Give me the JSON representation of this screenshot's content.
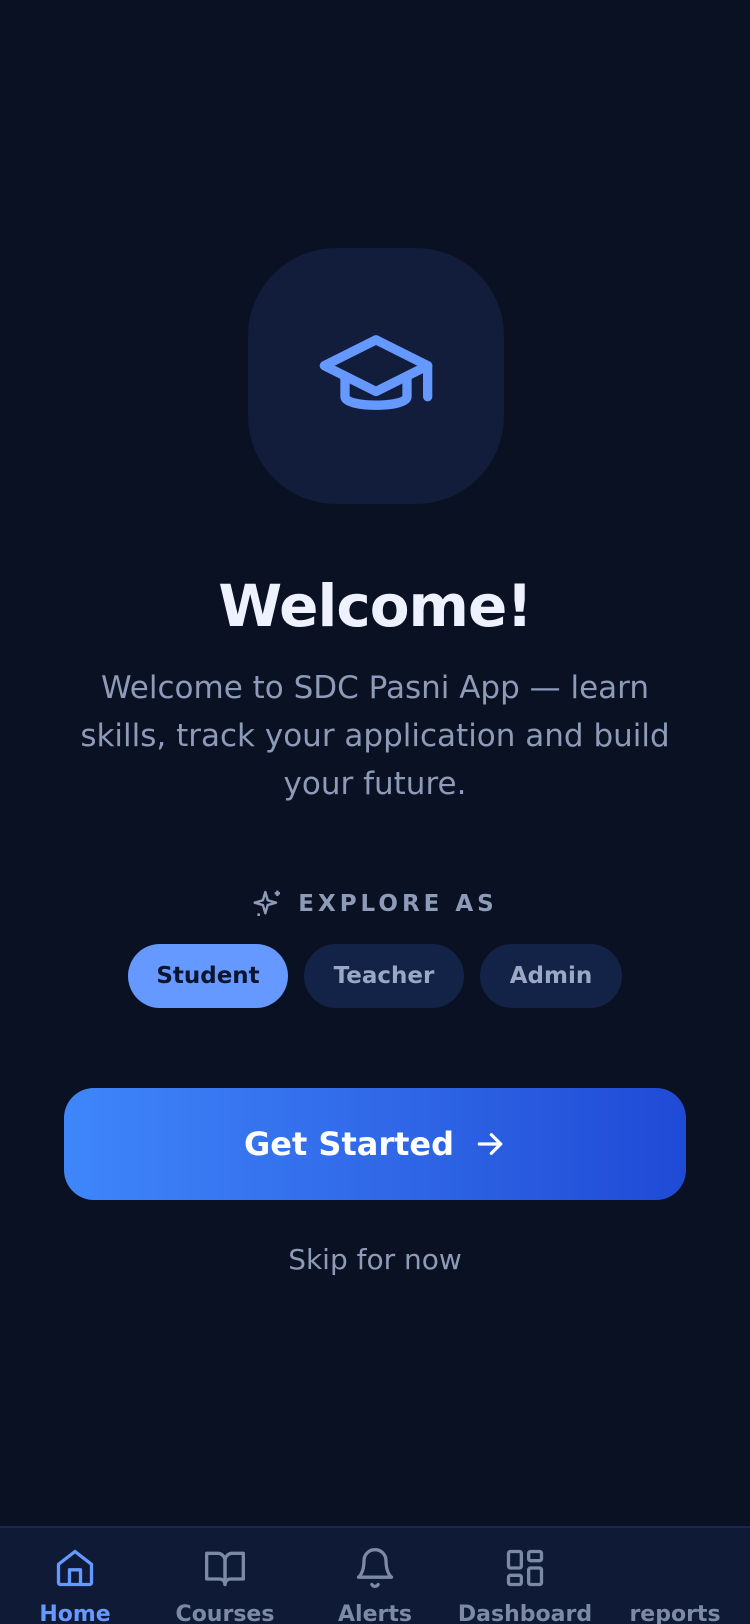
{
  "hero": {
    "icon": "graduation-cap-icon",
    "accent": "#6699ff"
  },
  "title": "Welcome!",
  "subtitle": "Welcome to SDC Pasni App — learn skills, track your application and build your future.",
  "explore": {
    "icon": "sparkle-icon",
    "label": "EXPLORE AS"
  },
  "roles": [
    {
      "label": "Student",
      "selected": true
    },
    {
      "label": "Teacher",
      "selected": false
    },
    {
      "label": "Admin",
      "selected": false
    }
  ],
  "cta": {
    "label": "Get Started",
    "icon": "arrow-right-icon"
  },
  "skip_label": "Skip for now",
  "tabs": [
    {
      "label": "Home",
      "icon": "home-icon",
      "active": true
    },
    {
      "label": "Courses",
      "icon": "book-open-icon",
      "active": false
    },
    {
      "label": "Alerts",
      "icon": "bell-icon",
      "active": false
    },
    {
      "label": "Dashboard",
      "icon": "grid-icon",
      "active": false
    },
    {
      "label": "reports",
      "icon": "report-icon",
      "active": false
    }
  ],
  "colors": {
    "background": "#0a1122",
    "surface": "#111d3a",
    "accent": "#6699ff",
    "cta_start": "#3f86fb",
    "cta_end": "#1f4ad6",
    "muted_text": "#8d9bb8"
  }
}
